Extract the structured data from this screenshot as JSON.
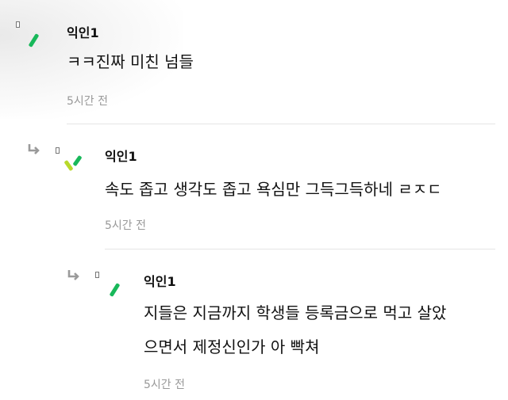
{
  "comments": [
    {
      "name": "익인1",
      "text": "ㅋㅋ진짜 미친 넘들",
      "time": "5시간 전",
      "avatar_colors": [
        "#18b85a"
      ]
    },
    {
      "name": "익인1",
      "text": "속도 좁고 생각도 좁고 욕심만 그득그득하네 ㄹㅈㄷ",
      "time": "5시간 전",
      "avatar_colors": [
        "#b8d92a",
        "#18b85a"
      ]
    },
    {
      "name": "익인1",
      "text_lines": [
        "지들은 지금까지 학생들 등록금으로 먹고 살았",
        "으면서 제정신인가 아 빡쳐"
      ],
      "time": "5시간 전",
      "avatar_colors": [
        "#18b85a"
      ]
    }
  ],
  "icons": {
    "reply": "reply-arrow-icon",
    "pin": "pin-icon"
  }
}
